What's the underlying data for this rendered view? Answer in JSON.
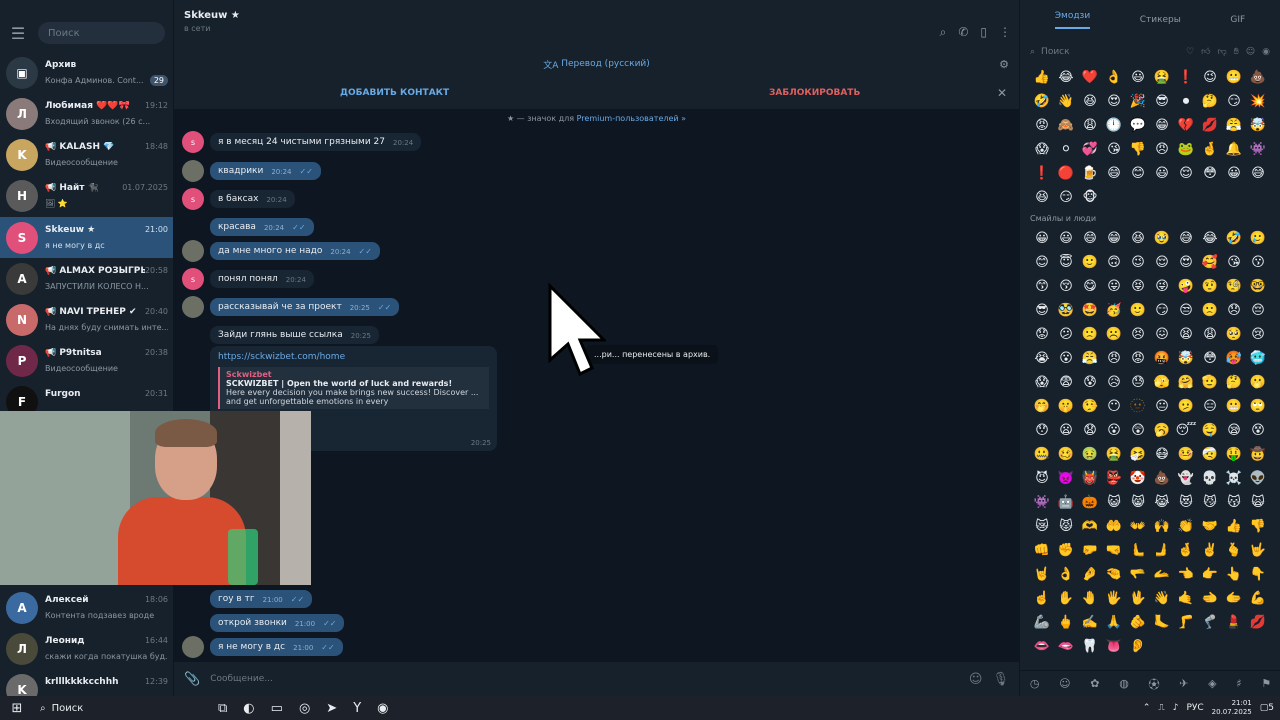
{
  "sidebar": {
    "search_placeholder": "Поиск",
    "chats": [
      {
        "name": "Архив",
        "last": "Конфа Админов. Cont...",
        "time": "",
        "badge": "29",
        "avatar_color": "#2b3945",
        "initial": "▣"
      },
      {
        "name": "Любимая ❤️❤️🎀",
        "last": "Входящий звонок (26 с...",
        "time": "19:12",
        "badge": "",
        "avatar_color": "#8a7a7a",
        "initial": "Л"
      },
      {
        "name": "📢 KALASH 💎",
        "last": "Видеосообщение",
        "time": "18:48",
        "badge": "",
        "avatar_color": "#c9a660",
        "initial": "K"
      },
      {
        "name": "📢 Найт 🐈‍⬛",
        "last": "🖼 ⭐",
        "time": "01.07.2025",
        "badge": "",
        "avatar_color": "#5a5a5a",
        "initial": "Н"
      },
      {
        "name": "Skkeuw ★",
        "last": "я не могу в дс",
        "time": "21:00",
        "badge": "",
        "avatar_color": "#e0507a",
        "initial": "S"
      },
      {
        "name": "📢 ALMAX РОЗЫГРЫ...",
        "last": "ЗАПУСТИЛИ КОЛЕСО Н...",
        "time": "20:58",
        "badge": "",
        "avatar_color": "#3a3a3a",
        "initial": "A"
      },
      {
        "name": "📢 NAVI ТРЕНЕР ✔",
        "last": "На днях буду снимать инте...",
        "time": "20:40",
        "badge": "",
        "avatar_color": "#c86a6a",
        "initial": "N"
      },
      {
        "name": "📢 P9tnitsa",
        "last": "Видеосообщение",
        "time": "20:38",
        "badge": "",
        "avatar_color": "#702848",
        "initial": "P"
      },
      {
        "name": "Furgon",
        "last": "",
        "time": "20:31",
        "badge": "",
        "avatar_color": "#101010",
        "initial": "F"
      },
      {
        "name": "Алексей",
        "last": "Контента подзавез вроде",
        "time": "18:06",
        "badge": "",
        "avatar_color": "#3a6aa0",
        "initial": "А"
      },
      {
        "name": "Леонид",
        "last": "скажи когда покатушка буд...",
        "time": "16:44",
        "badge": "",
        "avatar_color": "#4a4a3a",
        "initial": "Л"
      },
      {
        "name": "krlllkkkkcchhh",
        "last": "",
        "time": "12:39",
        "badge": "",
        "avatar_color": "#6a6a6a",
        "initial": "K"
      }
    ]
  },
  "chat": {
    "title": "Skkeuw ★",
    "status": "в сети",
    "translate": "Перевод (русский)",
    "add_contact": "ДОБАВИТЬ КОНТАКТ",
    "block": "ЗАБЛОКИРОВАТЬ",
    "premium_prefix": "— значок для ",
    "premium_link": "Premium-пользователей »",
    "messages": [
      {
        "text": "я в месяц 24 чистыми грязными 27",
        "time": "20:24",
        "out": false,
        "avatar": "s",
        "ticks": false
      },
      {
        "text": "квадрики",
        "time": "20:24",
        "out": true,
        "avatar": "me",
        "ticks": true
      },
      {
        "text": "в баксах",
        "time": "20:24",
        "out": false,
        "avatar": "s",
        "ticks": false
      },
      {
        "text": "красава",
        "time": "20:24",
        "out": true,
        "avatar": "none",
        "ticks": true
      },
      {
        "text": "да мне много не надо",
        "time": "20:24",
        "out": true,
        "avatar": "me",
        "ticks": true
      },
      {
        "text": "понял понял",
        "time": "20:24",
        "out": false,
        "avatar": "s",
        "ticks": false
      },
      {
        "text": "рассказывай че за проект",
        "time": "20:25",
        "out": true,
        "avatar": "me",
        "ticks": true
      },
      {
        "text": "Зайди глянь выше ссылка",
        "time": "20:25",
        "out": false,
        "avatar": "none",
        "ticks": false
      }
    ],
    "link_message": {
      "url": "https://sckwizbet.com/home",
      "site": "Sckwizbet",
      "title": "SCKWIZBET | Open the world of luck and rewards!",
      "desc": "Here every decision you make brings new success! Discover ... and get unforgettable emotions in every",
      "time": "20:25"
    },
    "late_messages": [
      {
        "text": "гоу в тг",
        "time": "21:00"
      },
      {
        "text": "открой звонки",
        "time": "21:00"
      },
      {
        "text": "я не могу в дс",
        "time": "21:00"
      }
    ],
    "toast": "...ри... перенесены в архив.",
    "compose_placeholder": "Сообщение..."
  },
  "emoji_panel": {
    "tabs": [
      "Эмодзи",
      "Стикеры",
      "GIF"
    ],
    "search_placeholder": "Поиск",
    "recent": [
      "👍",
      "😂",
      "❤️",
      "👌",
      "😃",
      "🤮",
      "❗",
      "😉",
      "😬",
      "💩",
      "🤣",
      "👋",
      "😆",
      "😍",
      "🎉",
      "😎",
      "⏺",
      "🤔",
      "😏",
      "💥",
      "😡",
      "🙈",
      "😩",
      "🕛",
      "💬",
      "😁",
      "💔",
      "💋",
      "😤",
      "🤯",
      "😱",
      "⚪",
      "💞",
      "😘",
      "👎",
      "😠",
      "🐸",
      "🤞",
      "🔔",
      "👾",
      "❗",
      "🔴",
      "🍺",
      "😄",
      "😊",
      "😃",
      "😌",
      "😳",
      "😀",
      "😅",
      "😆",
      "😏",
      "🐵"
    ],
    "section_title": "Смайлы и люди",
    "smileys": [
      "😀",
      "😃",
      "😄",
      "😁",
      "😆",
      "🥹",
      "😅",
      "😂",
      "🤣",
      "🥲",
      "😊",
      "😇",
      "🙂",
      "🙃",
      "😉",
      "😌",
      "😍",
      "🥰",
      "😘",
      "😗",
      "😙",
      "😚",
      "😋",
      "😛",
      "😝",
      "😜",
      "🤪",
      "🤨",
      "🧐",
      "🤓",
      "😎",
      "🥸",
      "🤩",
      "🥳",
      "🙂",
      "😏",
      "😒",
      "🙁",
      "😞",
      "😔",
      "😟",
      "😕",
      "🙁",
      "☹️",
      "😣",
      "😖",
      "😫",
      "😩",
      "🥺",
      "😢",
      "😭",
      "😮",
      "😤",
      "😠",
      "😡",
      "🤬",
      "🤯",
      "😳",
      "🥵",
      "🥶",
      "😱",
      "😨",
      "😰",
      "😥",
      "😓",
      "🫣",
      "🤗",
      "🫡",
      "🤔",
      "🫢",
      "🤭",
      "🤫",
      "🤥",
      "😶",
      "🫥",
      "😐",
      "🫤",
      "😑",
      "😬",
      "🙄",
      "😯",
      "😦",
      "😧",
      "😮",
      "😲",
      "🥱",
      "😴",
      "🤤",
      "😪",
      "😵",
      "🤐",
      "🥴",
      "🤢",
      "🤮",
      "🤧",
      "😷",
      "🤒",
      "🤕",
      "🤑",
      "🤠",
      "😈",
      "👿",
      "👹",
      "👺",
      "🤡",
      "💩",
      "👻",
      "💀",
      "☠️",
      "👽",
      "👾",
      "🤖",
      "🎃",
      "😺",
      "😸",
      "😹",
      "😻",
      "😼",
      "😽",
      "🙀",
      "😿",
      "😾",
      "🫶",
      "🤲",
      "👐",
      "🙌",
      "👏",
      "🤝",
      "👍",
      "👎",
      "👊",
      "✊",
      "🤛",
      "🤜",
      "🫷",
      "🫸",
      "🤞",
      "✌️",
      "🫰",
      "🤟",
      "🤘",
      "👌",
      "🤌",
      "🤏",
      "🫳",
      "🫴",
      "👈",
      "👉",
      "👆",
      "👇",
      "☝️",
      "✋",
      "🤚",
      "🖐",
      "🖖",
      "👋",
      "🤙",
      "🫲",
      "🫱",
      "💪",
      "🦾",
      "🖕",
      "✍️",
      "🙏",
      "🫵",
      "🦶",
      "🦵",
      "🦿",
      "💄",
      "💋",
      "👄",
      "🫦",
      "🦷",
      "👅",
      "👂"
    ]
  },
  "taskbar": {
    "search": "Поиск",
    "lang": "РУС",
    "time": "21:01",
    "date": "20.07.2025",
    "notif": "5"
  }
}
